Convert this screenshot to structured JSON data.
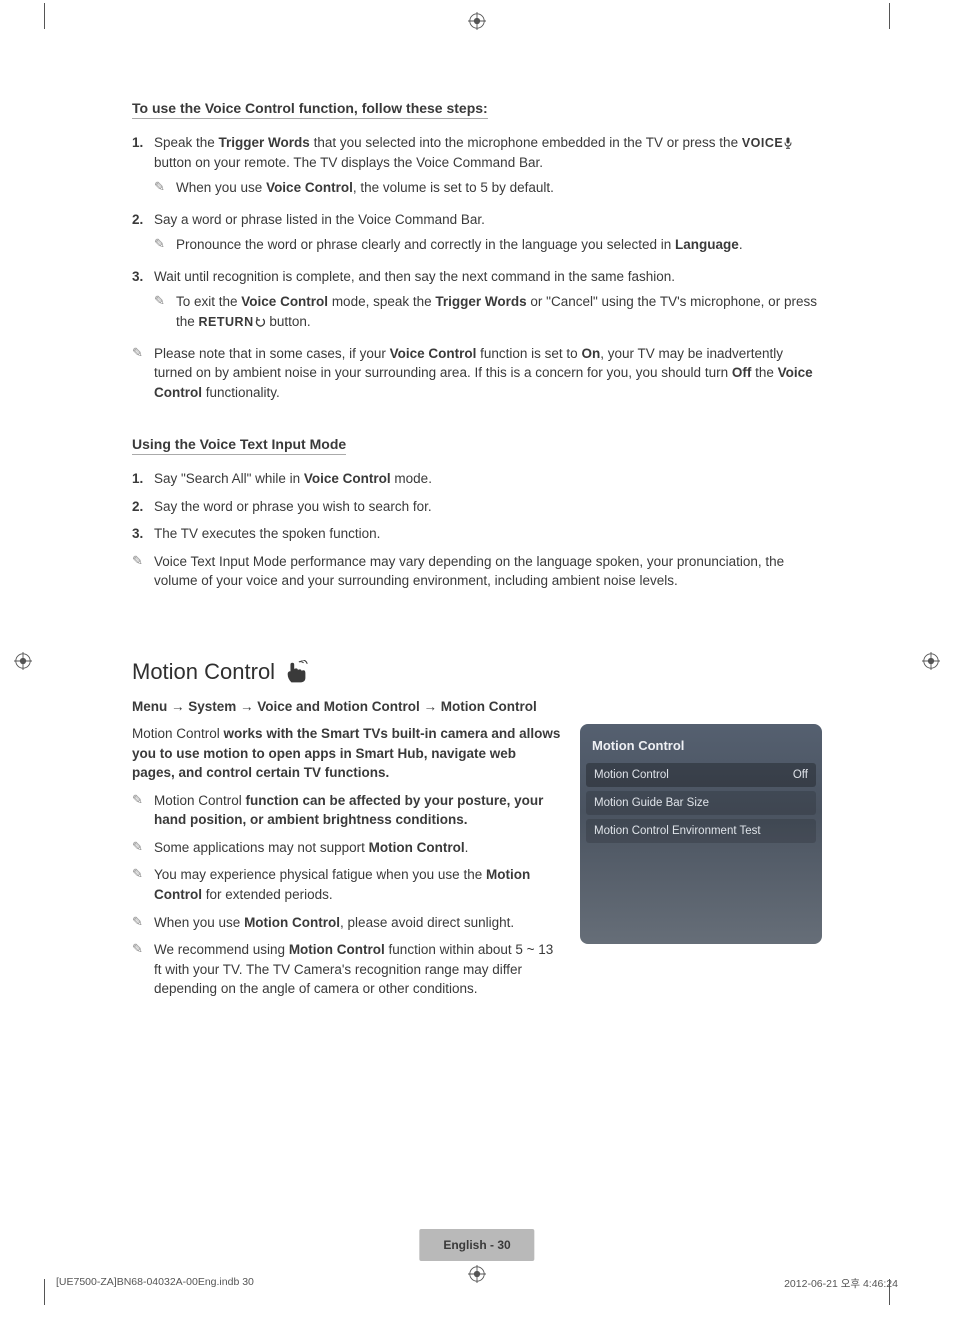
{
  "section1": {
    "heading": "To use the Voice Control function, follow these steps:",
    "items": [
      {
        "num": "1.",
        "text_parts": [
          "Speak the ",
          "Trigger Words",
          " that you selected into the microphone embedded in the TV or press the ",
          "VOICE",
          " button on your remote. The TV displays the Voice Command Bar."
        ],
        "sub": {
          "parts": [
            "When you use ",
            "Voice Control",
            ", the volume is set to 5 by default."
          ]
        }
      },
      {
        "num": "2.",
        "text_parts": [
          "Say a word or phrase listed in the Voice Command Bar."
        ],
        "sub": {
          "parts": [
            "Pronounce the word or phrase clearly and correctly in the language you selected in ",
            "Language",
            "."
          ]
        }
      },
      {
        "num": "3.",
        "text_parts": [
          "Wait until recognition is complete, and then say the next command in the same fashion."
        ],
        "sub": {
          "parts": [
            "To exit the ",
            "Voice Control",
            " mode, speak the ",
            "Trigger Words",
            " or \"Cancel\" using the TV's microphone, or press the ",
            "RETURN",
            " button."
          ]
        }
      }
    ],
    "trailing_note_parts": [
      "Please note that in some cases, if your ",
      "Voice Control",
      " function is set to ",
      "On",
      ", your TV may be inadvertently turned on by ambient noise in your surrounding area. If this is a concern for you, you should turn ",
      "Off",
      " the ",
      "Voice Control",
      " functionality."
    ]
  },
  "section2": {
    "heading": "Using the Voice Text Input Mode",
    "items": [
      {
        "num": "1.",
        "parts": [
          "Say \"Search All\" while in ",
          "Voice Control",
          " mode."
        ]
      },
      {
        "num": "2.",
        "parts": [
          "Say the word or phrase you wish to search for."
        ]
      },
      {
        "num": "3.",
        "parts": [
          "The TV executes the spoken function."
        ]
      }
    ],
    "note_parts": [
      "Voice Text Input Mode performance may vary depending on the language spoken, your pronunciation, the volume of your voice and your surrounding environment, including ambient noise levels."
    ]
  },
  "section3": {
    "title": "Motion Control",
    "menu_path": "Menu → System → Voice and Motion Control → Motion Control",
    "intro_parts": [
      "Motion Control",
      " works with the Smart TVs built-in camera and allows you to use motion to open apps in Smart Hub, navigate web pages, and control certain TV functions."
    ],
    "notes": [
      [
        "Motion Control",
        " function can be affected by your posture, your hand position, or ambient brightness conditions."
      ],
      [
        "Some applications may not support ",
        "Motion Control",
        "."
      ],
      [
        "You may experience physical fatigue when you use the ",
        "Motion Control",
        " for extended periods."
      ],
      [
        "When you use ",
        "Motion Control",
        ", please avoid direct sunlight."
      ],
      [
        "We recommend using ",
        "Motion Control",
        " function within about 5 ~ 13 ft with your TV. The TV Camera's recognition range may differ depending on the angle of camera or other conditions."
      ]
    ],
    "panel": {
      "title": "Motion Control",
      "rows": [
        {
          "label": "Motion Control",
          "value": "Off"
        },
        {
          "label": "Motion Guide Bar Size",
          "value": ""
        },
        {
          "label": "Motion Control Environment Test",
          "value": ""
        }
      ]
    }
  },
  "footer": {
    "center": "English - 30",
    "left": "[UE7500-ZA]BN68-04032A-00Eng.indb   30",
    "right": "2012-06-21   오후 4:46:24"
  }
}
